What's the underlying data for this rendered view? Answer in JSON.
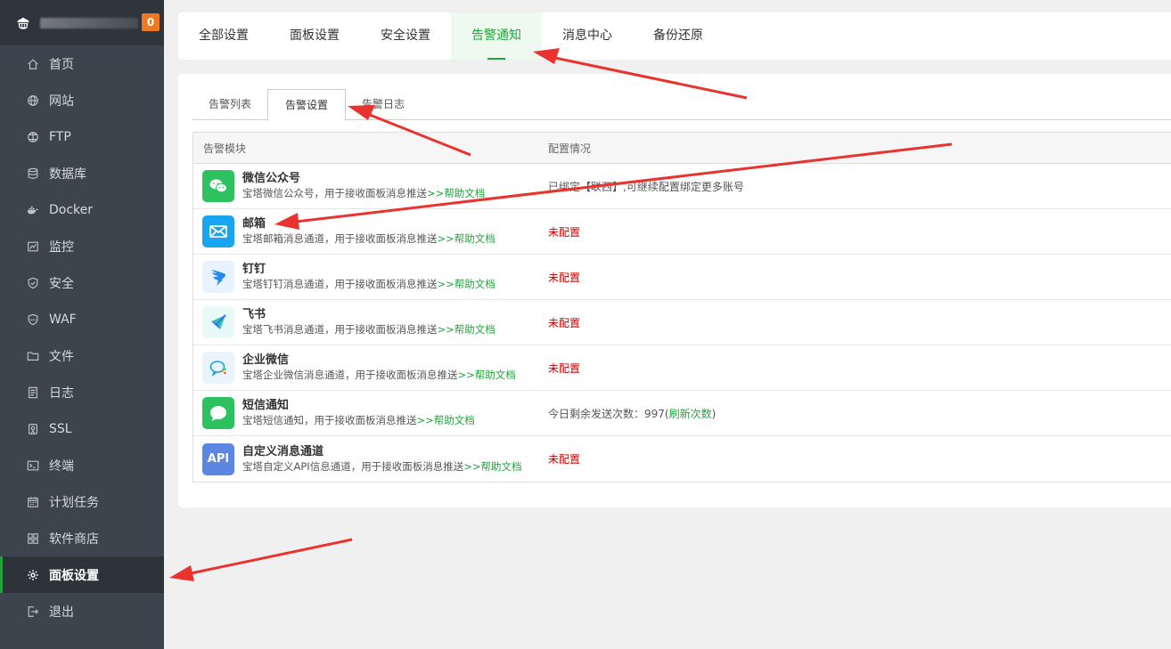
{
  "sidebar": {
    "badge": "0",
    "items": [
      {
        "label": "首页",
        "icon": "home-icon"
      },
      {
        "label": "网站",
        "icon": "globe-icon"
      },
      {
        "label": "FTP",
        "icon": "ftp-globe-icon"
      },
      {
        "label": "数据库",
        "icon": "database-icon"
      },
      {
        "label": "Docker",
        "icon": "docker-icon"
      },
      {
        "label": "监控",
        "icon": "monitor-chart-icon"
      },
      {
        "label": "安全",
        "icon": "shield-icon"
      },
      {
        "label": "WAF",
        "icon": "waf-shield-icon"
      },
      {
        "label": "文件",
        "icon": "folder-icon"
      },
      {
        "label": "日志",
        "icon": "log-file-icon"
      },
      {
        "label": "SSL",
        "icon": "ssl-icon"
      },
      {
        "label": "终端",
        "icon": "terminal-icon"
      },
      {
        "label": "计划任务",
        "icon": "calendar-icon"
      },
      {
        "label": "软件商店",
        "icon": "apps-grid-icon"
      },
      {
        "label": "面板设置",
        "icon": "gear-icon",
        "active": true
      },
      {
        "label": "退出",
        "icon": "logout-icon"
      }
    ]
  },
  "top_tabs": [
    {
      "label": "全部设置"
    },
    {
      "label": "面板设置"
    },
    {
      "label": "安全设置"
    },
    {
      "label": "告警通知",
      "active": true
    },
    {
      "label": "消息中心"
    },
    {
      "label": "备份还原"
    }
  ],
  "sub_tabs": [
    {
      "label": "告警列表"
    },
    {
      "label": "告警设置",
      "active": true
    },
    {
      "label": "告警日志"
    }
  ],
  "table": {
    "headers": [
      "告警模块",
      "配置情况"
    ],
    "help_link": ">>帮助文档",
    "rows": [
      {
        "name": "微信公众号",
        "desc": "宝塔微信公众号，用于接收面板消息推送",
        "status": "已绑定【联西】,可继续配置绑定更多账号",
        "status_type": "bound",
        "icon": "wechat-icon",
        "color": "#2dc15f"
      },
      {
        "name": "邮箱",
        "desc": "宝塔邮箱消息通道，用于接收面板消息推送",
        "status": "未配置",
        "status_type": "unconfigured",
        "icon": "mail-icon",
        "color": "#1aa5f0"
      },
      {
        "name": "钉钉",
        "desc": "宝塔钉钉消息通道，用于接收面板消息推送",
        "status": "未配置",
        "status_type": "unconfigured",
        "icon": "dingtalk-icon",
        "color": "#e8f3ff"
      },
      {
        "name": "飞书",
        "desc": "宝塔飞书消息通道，用于接收面板消息推送",
        "status": "未配置",
        "status_type": "unconfigured",
        "icon": "feishu-icon",
        "color": "#e9f9f7"
      },
      {
        "name": "企业微信",
        "desc": "宝塔企业微信消息通道，用于接收面板消息推送",
        "status": "未配置",
        "status_type": "unconfigured",
        "icon": "wecom-icon",
        "color": "#eaf4fd"
      },
      {
        "name": "短信通知",
        "desc": "宝塔短信通知，用于接收面板消息推送",
        "status": "今日剩余发送次数：997(",
        "status_link": "刷新次数",
        "status_tail": ")",
        "status_type": "sms",
        "icon": "sms-bubble-icon",
        "color": "#2dc15f"
      },
      {
        "name": "自定义消息通道",
        "desc": "宝塔自定义API信息通道，用于接收面板消息推送",
        "status": "未配置",
        "status_type": "unconfigured",
        "icon": "api-icon",
        "icon_text": "API",
        "color": "#5b87e0"
      }
    ]
  },
  "colors": {
    "accent": "#20a53a",
    "sidebar_bg": "#3c444d",
    "unconfigured": "#cc0000",
    "badge": "#f0781e",
    "annotation_arrow": "#e8332e"
  }
}
